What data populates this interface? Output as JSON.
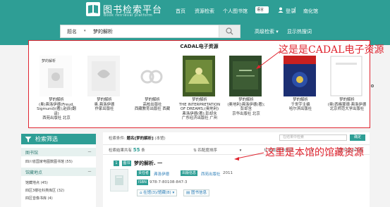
{
  "header": {
    "logo_title": "图书检索平台",
    "logo_subtitle": "Book retrieval platform",
    "nav": [
      "首页",
      "资源检索",
      "个人图书馆"
    ],
    "language": "语言",
    "login": "登录",
    "institution": "南化馆"
  },
  "search": {
    "field": "题名",
    "query": "梦的解析",
    "advanced": "高级检索",
    "display": "显示热搜词"
  },
  "cadal": {
    "title": "CADAL电子资源",
    "annotation": "这是是CADAL电子资源",
    "books": [
      {
        "cover_text": "梦的解析",
        "lines": [
          "梦的解析",
          "(奥)弗洛伊德(Freud,",
          "Sigmund)(著);赵辰(翻",
          "译)",
          "西苑出版社 北京"
        ]
      },
      {
        "cover_text": "",
        "lines": [
          "梦的解析",
          "奥.弗洛伊德",
          "作家出版社"
        ]
      },
      {
        "cover_text": "",
        "lines": [
          "梦的解析",
          "高校出版社",
          "西藏教育出版社 西藏"
        ]
      },
      {
        "cover_text": "",
        "lines": [
          "梦的解析",
          "THE INTERPRETATION",
          "OF DREAMS;(奥地利)",
          "弗洛伊德(著);彭却含",
          "广东经济出版社 广州"
        ]
      },
      {
        "cover_text": "",
        "lines": [
          "梦的解析",
          "(奥地利)弗洛伊德(著);",
          "彭却含",
          "京华出版社 北京"
        ]
      },
      {
        "cover_text": "",
        "lines": [
          "梦的解析",
          "于世宇主编",
          "哈尔滨出版社"
        ]
      },
      {
        "cover_text": "",
        "lines": [
          "梦的解析",
          "(奥)西格蒙德·弗洛伊德",
          "北京师范大学出版社"
        ]
      }
    ]
  },
  "sidebar": {
    "title": "检索筛选",
    "sections": [
      {
        "label": "图书馆",
        "toggle": "－"
      },
      {
        "label": "馆藏地点",
        "toggle": "－"
      }
    ],
    "items": [
      "四川省国家电图数图书馆 (55)",
      "馆藏地点 (45)",
      "四区3楼社科类库区 (32)",
      "四区音像书库 (4)"
    ]
  },
  "results": {
    "condition_label": "检索条件:",
    "condition_value": "题名[梦的解析]",
    "condition_suffix": "(本馆)",
    "search_placeholder": "在结果中检索",
    "confirm": "确定",
    "total_prefix": "检索结果共有",
    "total_count": "55",
    "total_suffix": "条",
    "sort": "匹配度排序",
    "order": "出版/发布时间",
    "available_only": "只显示可借",
    "annotation": "这里是本馆的馆藏资源",
    "record": {
      "index": "1",
      "type": "图书",
      "title": "梦的解析. 一",
      "author_tag": "责任者",
      "author": "弗洛伊德",
      "publisher_tag": "出版信息",
      "publisher": "西苑出版社",
      "year": "2011",
      "isbn_tag": "ISBN",
      "isbn": "978-7-80108-847-3",
      "holdings": "在馆(3)/馆藏(8)",
      "info": "图书信息"
    }
  }
}
